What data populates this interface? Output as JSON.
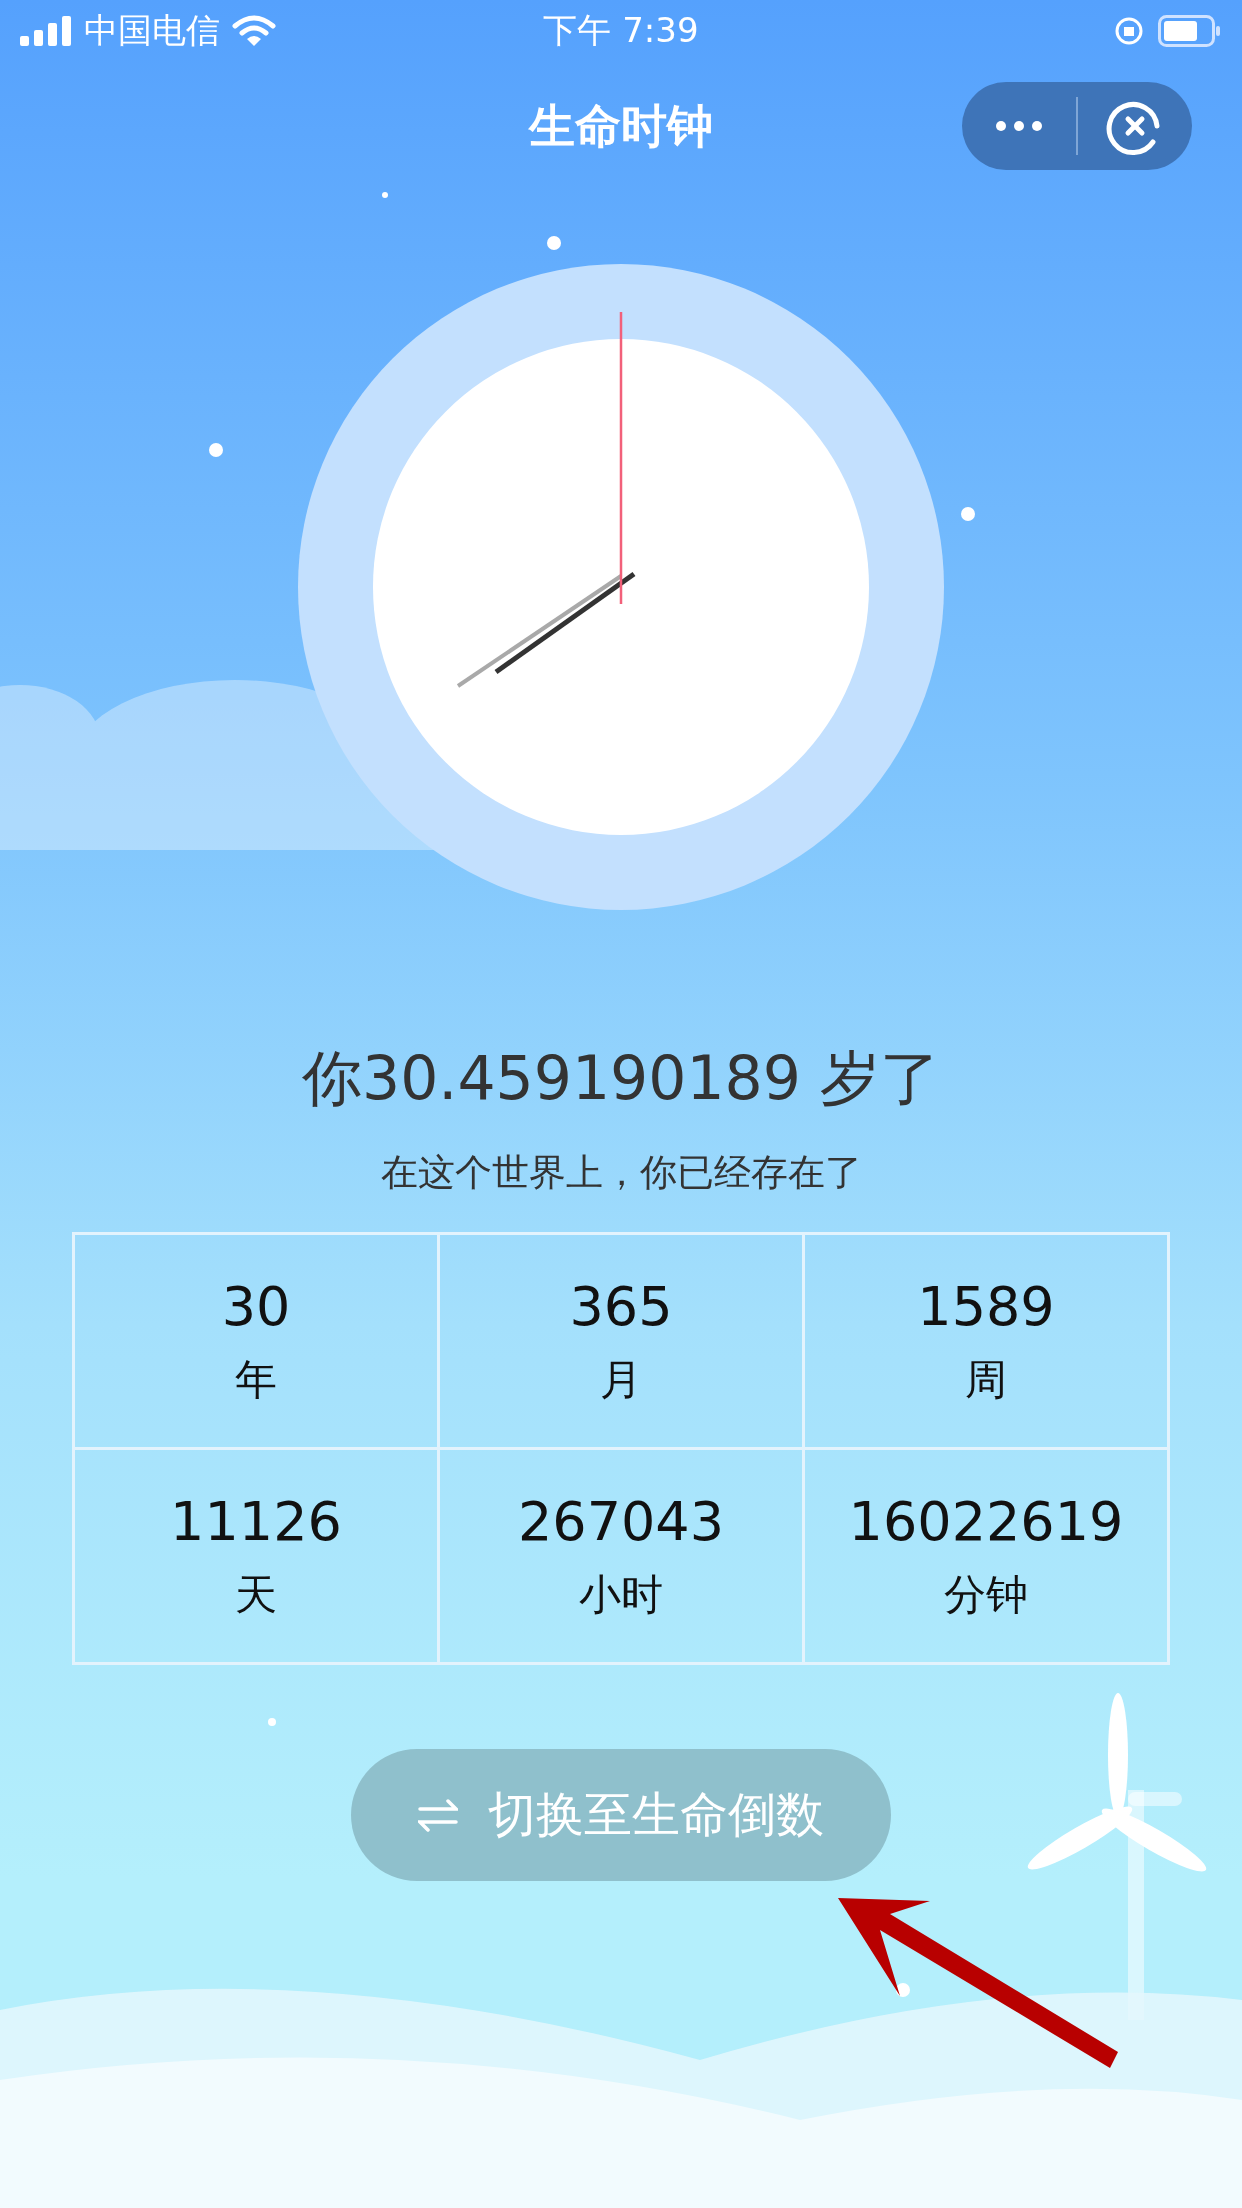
{
  "status_bar": {
    "carrier": "中国电信",
    "time": "下午 7:39"
  },
  "nav": {
    "title": "生命时钟"
  },
  "age": {
    "text": "你30.459190189 岁了",
    "subtitle": "在这个世界上，你已经存在了"
  },
  "stats": [
    {
      "value": "30",
      "unit": "年"
    },
    {
      "value": "365",
      "unit": "月"
    },
    {
      "value": "1589",
      "unit": "周"
    },
    {
      "value": "11126",
      "unit": "天"
    },
    {
      "value": "267043",
      "unit": "小时"
    },
    {
      "value": "16022619",
      "unit": "分钟"
    }
  ],
  "switch_button": {
    "label": "切换至生命倒数"
  }
}
